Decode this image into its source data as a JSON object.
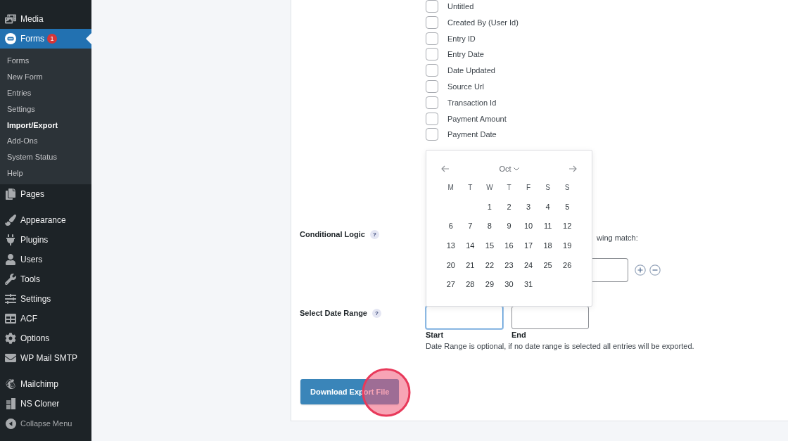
{
  "sidebar": {
    "groups": [
      {
        "items": [
          {
            "label": "Media",
            "selected": false
          },
          {
            "label": "Forms",
            "selected": true,
            "badge": "1",
            "children": [
              {
                "label": "Forms",
                "selected": false
              },
              {
                "label": "New Form",
                "selected": false
              },
              {
                "label": "Entries",
                "selected": false
              },
              {
                "label": "Settings",
                "selected": false
              },
              {
                "label": "Import/Export",
                "selected": true
              },
              {
                "label": "Add-Ons",
                "selected": false
              },
              {
                "label": "System Status",
                "selected": false
              },
              {
                "label": "Help",
                "selected": false
              }
            ]
          },
          {
            "label": "Pages",
            "selected": false
          }
        ]
      },
      {
        "items": [
          {
            "label": "Appearance",
            "selected": false
          },
          {
            "label": "Plugins",
            "selected": false
          },
          {
            "label": "Users",
            "selected": false
          },
          {
            "label": "Tools",
            "selected": false
          },
          {
            "label": "Settings",
            "selected": false
          },
          {
            "label": "ACF",
            "selected": false
          },
          {
            "label": "Options",
            "selected": false
          },
          {
            "label": "WP Mail SMTP",
            "selected": false
          }
        ]
      },
      {
        "items": [
          {
            "label": "Mailchimp",
            "selected": false
          },
          {
            "label": "NS Cloner",
            "selected": false
          }
        ]
      }
    ],
    "collapse_label": "Collapse Menu"
  },
  "export_form": {
    "field_options": [
      {
        "label": "Untitled",
        "checked": false
      },
      {
        "label": "Created By (User Id)",
        "checked": false
      },
      {
        "label": "Entry ID",
        "checked": false
      },
      {
        "label": "Entry Date",
        "checked": false
      },
      {
        "label": "Date Updated",
        "checked": false
      },
      {
        "label": "Source Url",
        "checked": false
      },
      {
        "label": "Transaction Id",
        "checked": false
      },
      {
        "label": "Payment Amount",
        "checked": false
      },
      {
        "label": "Payment Date",
        "checked": false
      }
    ],
    "conditional_logic": {
      "label": "Conditional Logic",
      "help": "?",
      "text": "wing match:"
    },
    "date_range": {
      "label": "Select Date Range",
      "help": "?",
      "fields": [
        {
          "label": "Start",
          "focused": true
        },
        {
          "label": "End",
          "focused": false
        }
      ],
      "description": "Date Range is optional, if no date range is selected all entries will be exported."
    },
    "download_button": "Download Export File"
  },
  "date_picker": {
    "month": "Oct",
    "weekdays": [
      "M",
      "T",
      "W",
      "T",
      "F",
      "S",
      "S"
    ],
    "weeks": [
      {
        "days": [
          "1",
          "2",
          "3",
          "4",
          "5"
        ]
      },
      {
        "days": [
          "6",
          "7",
          "8",
          "9",
          "10",
          "11",
          "12"
        ]
      },
      {
        "days": [
          "13",
          "14",
          "15",
          "16",
          "17",
          "18",
          "19"
        ]
      },
      {
        "days": [
          "20",
          "21",
          "22",
          "23",
          "24",
          "25",
          "26"
        ]
      },
      {
        "days": [
          "27",
          "28",
          "29",
          "30",
          "31"
        ]
      }
    ]
  }
}
